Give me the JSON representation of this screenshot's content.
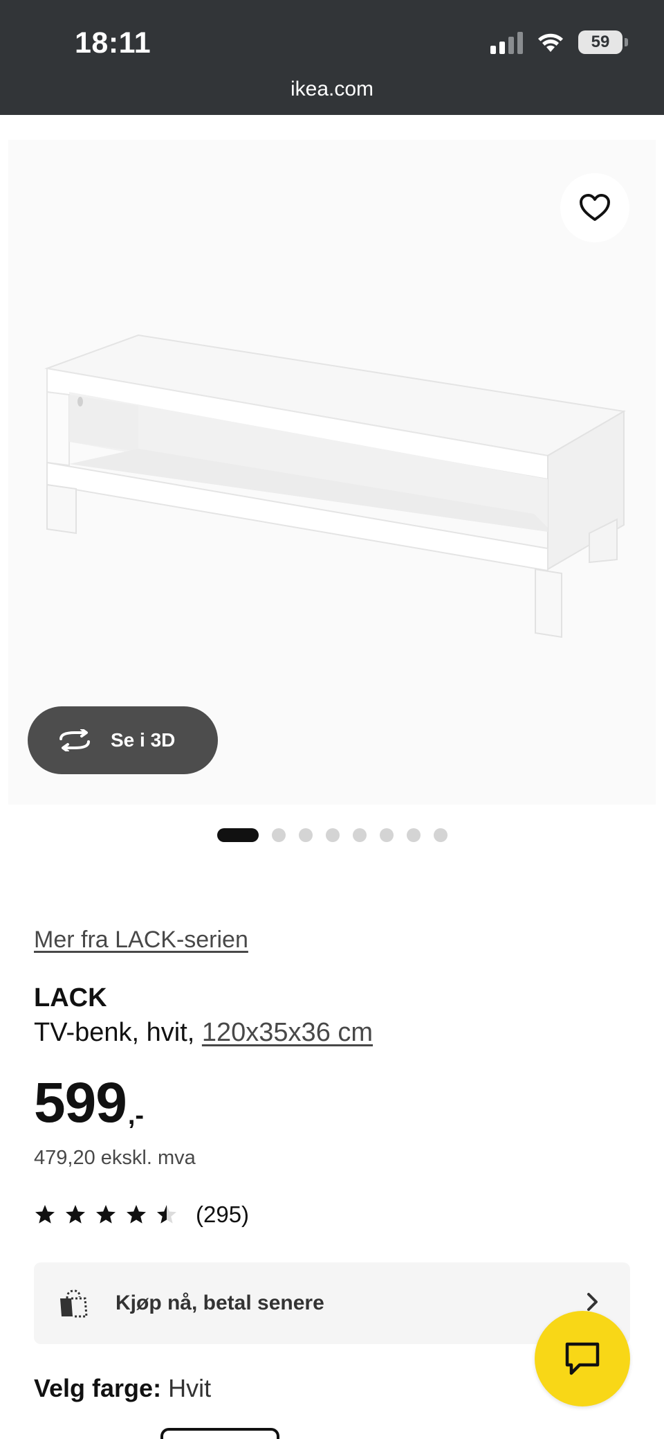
{
  "status_bar": {
    "time": "18:11",
    "battery": "59"
  },
  "browser": {
    "url": "ikea.com"
  },
  "gallery": {
    "view_3d_label": "Se i 3D",
    "dots_count": 8,
    "active_dot": 1
  },
  "product": {
    "series_link": "Mer fra LACK-serien",
    "name": "LACK",
    "description": "TV-benk, hvit, ",
    "dimensions": "120x35x36 cm",
    "price_integer": "599",
    "price_suffix": ",-",
    "price_excl_vat": "479,20 ekskl. mva",
    "rating_value": 4.5,
    "rating_count": "(295)"
  },
  "bnpl": {
    "label": "Kjøp nå, betal senere"
  },
  "color": {
    "label": "Velg farge:",
    "value": "Hvit"
  },
  "colors": {
    "topbar": "#323538",
    "chat_fab": "#f8d717",
    "pill": "#4d4d4d"
  }
}
